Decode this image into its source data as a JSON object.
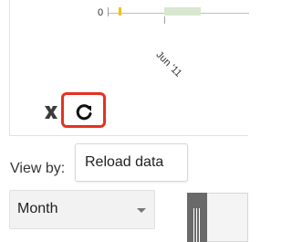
{
  "chart": {
    "zero_label": "0",
    "month_label": "Jun '11"
  },
  "toolbar": {
    "reset_icon": "reset-zoom-icon",
    "reload_icon": "reload-icon",
    "reload_tooltip": "Reload data"
  },
  "controls": {
    "view_by_label": "View by:",
    "selected_period": "Month"
  },
  "colors": {
    "highlight": "#e53222",
    "marker": "#f2c200",
    "band": "#d8e8d0"
  }
}
